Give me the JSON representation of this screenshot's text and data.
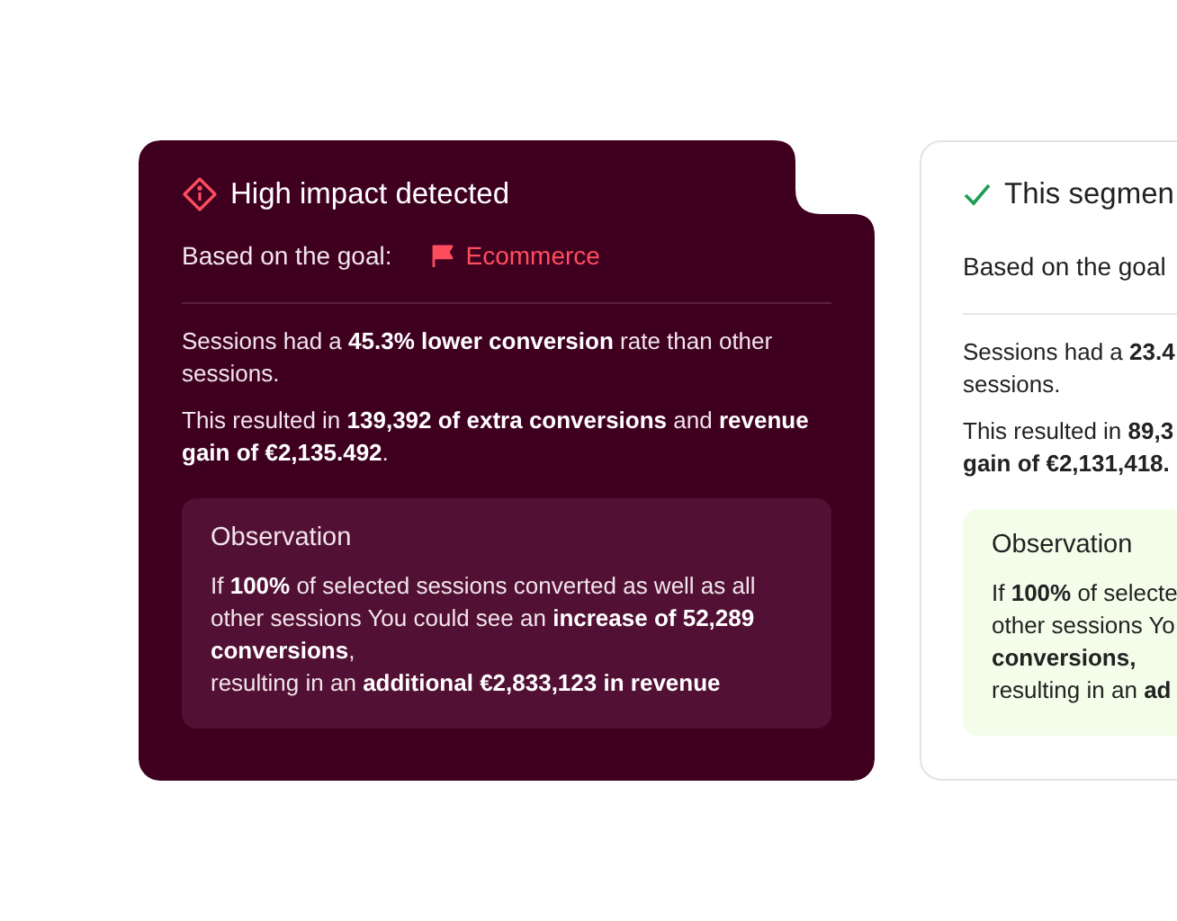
{
  "cards": [
    {
      "kind": "alert",
      "title": "High impact detected",
      "goal_label": "Based on the goal:",
      "goal_value": "Ecommerce",
      "paragraphs": [
        [
          "Sessions had a **45.3% lower conversion** rate than other",
          "sessions."
        ],
        [
          "This resulted in **139,392 of extra conversions** and **revenue**",
          "**gain of €2,135.492**."
        ]
      ],
      "observation": {
        "title": "Observation",
        "lines": [
          "If **100%** of selected sessions converted as well as all",
          "other sessions You could see an **increase of 52,289**",
          "**conversions**,",
          "resulting in an **additional €2,833,123 in revenue**"
        ]
      }
    },
    {
      "kind": "success",
      "title": "This segmen",
      "goal_label": "Based on the goal",
      "paragraphs": [
        [
          "Sessions had a **23.4**",
          "sessions."
        ],
        [
          "This resulted in **89,3**",
          "**gain of €2,131,418.**"
        ]
      ],
      "observation": {
        "title": "Observation",
        "lines": [
          "If **100%** of selecte",
          "other sessions Yo",
          "**conversions,**",
          "resulting in an **ad**"
        ]
      }
    }
  ]
}
